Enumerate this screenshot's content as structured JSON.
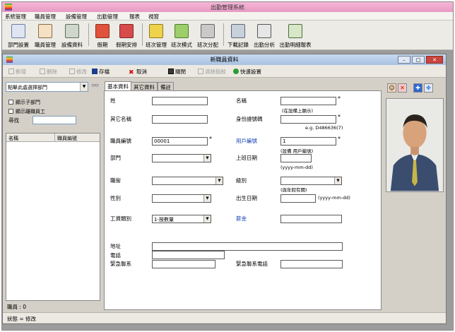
{
  "app": {
    "title": "出勤管理系統"
  },
  "menu": [
    "系統管理",
    "職員管理",
    "設備管理",
    "出勤管理",
    "報表",
    "視窗"
  ],
  "toolbar": [
    {
      "label": "部門設置",
      "icon": "department-icon"
    },
    {
      "label": "職員管理",
      "icon": "staff-icon"
    },
    {
      "label": "設備資料",
      "icon": "device-icon"
    },
    {
      "label": "假期",
      "icon": "holiday-icon"
    },
    {
      "label": "假期安排",
      "icon": "holiday-schedule-icon"
    },
    {
      "label": "班次管理",
      "icon": "shift-icon"
    },
    {
      "label": "班次模式",
      "icon": "shift-mode-icon"
    },
    {
      "label": "班次分配",
      "icon": "shift-assign-icon"
    },
    {
      "label": "下載記錄",
      "icon": "download-icon"
    },
    {
      "label": "出勤分析",
      "icon": "analysis-icon"
    },
    {
      "label": "出勤明細報表",
      "icon": "report-icon"
    }
  ],
  "window": {
    "title": "新職員資料"
  },
  "win_tools": {
    "add": "新增",
    "delete": "刪除",
    "edit": "修改",
    "save": "存檔",
    "cancel": "取消",
    "close": "關閉",
    "clear_fp": "清除指紋",
    "quick_setup": "快速設置"
  },
  "left": {
    "dept_placeholder": "點擊此處選擇部門",
    "show_sub": "顯示子部門",
    "show_resigned": "顯示離職員工",
    "search_label": "尋找",
    "col_name": "名稱",
    "col_id": "職員編號",
    "count": "職員 : 0"
  },
  "status": "狀態 = 修改",
  "tabs": [
    "基本資料",
    "其它資料",
    "備註"
  ],
  "form": {
    "surname": "姓",
    "name": "名稱",
    "name_hint": "(在設備上顯示)",
    "other_name": "其它名稱",
    "id_no": "身份證號碼",
    "id_hint": "e.g. D486636(7)",
    "staff_no": "職員編號",
    "staff_no_value": "00001",
    "user_no": "用戶編號",
    "user_no_value": "1",
    "user_no_hint": "(設備 用戶編號)",
    "dept": "部門",
    "join_date": "上班日期",
    "date_fmt": "(yyyy-mm-dd)",
    "title": "職銜",
    "grade": "級別",
    "grade_hint": "(與年假有關)",
    "sex": "性別",
    "birth": "出生日期",
    "birth_fmt": "(yyyy-mm-dd)",
    "wage_type": "工資類別",
    "wage_type_value": "1-按數量",
    "salary": "薪金",
    "address": "地址",
    "phone": "電話",
    "emergency": "緊急聯系",
    "emergency_phone": "緊急聯系電話"
  }
}
